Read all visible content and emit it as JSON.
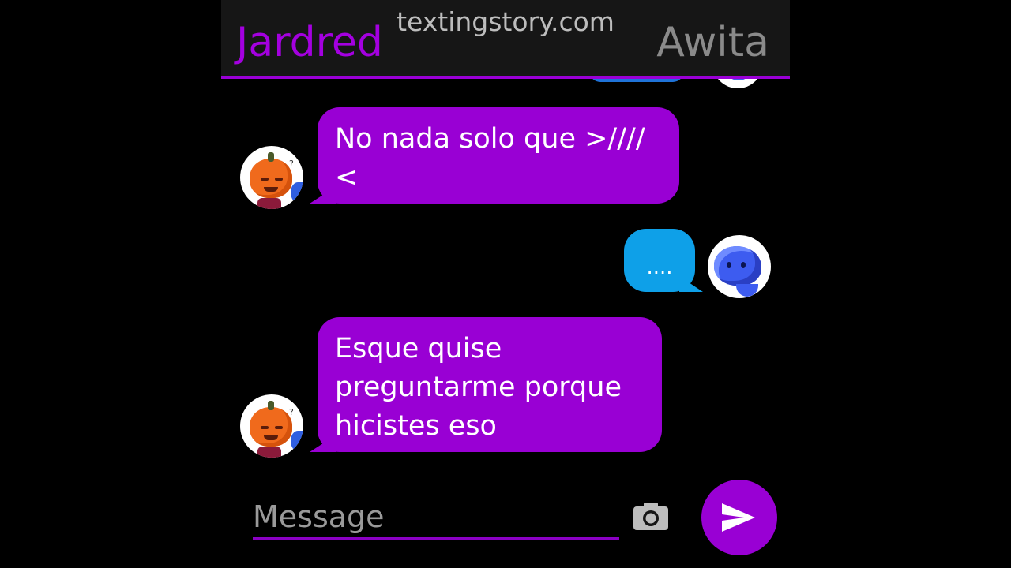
{
  "header": {
    "contact_left": "Jardred",
    "watermark": "textingstory.com",
    "contact_right": "Awita"
  },
  "messages": [
    {
      "sender": "Jardred",
      "side": "left",
      "text_lines": [
        "No nada solo que >////",
        "<"
      ]
    },
    {
      "sender": "Awita",
      "side": "right",
      "text": "...."
    },
    {
      "sender": "Jardred",
      "side": "left",
      "text_lines": [
        "Esque quise",
        "preguntarme porque",
        "hicistes eso"
      ]
    }
  ],
  "composer": {
    "placeholder": "Message",
    "camera_icon": "camera-icon",
    "send_icon": "send-icon"
  },
  "colors": {
    "incoming_bubble": "#9900d4",
    "outgoing_bubble": "#0ea0e8",
    "accent": "#9a00d6",
    "background": "#000000"
  }
}
